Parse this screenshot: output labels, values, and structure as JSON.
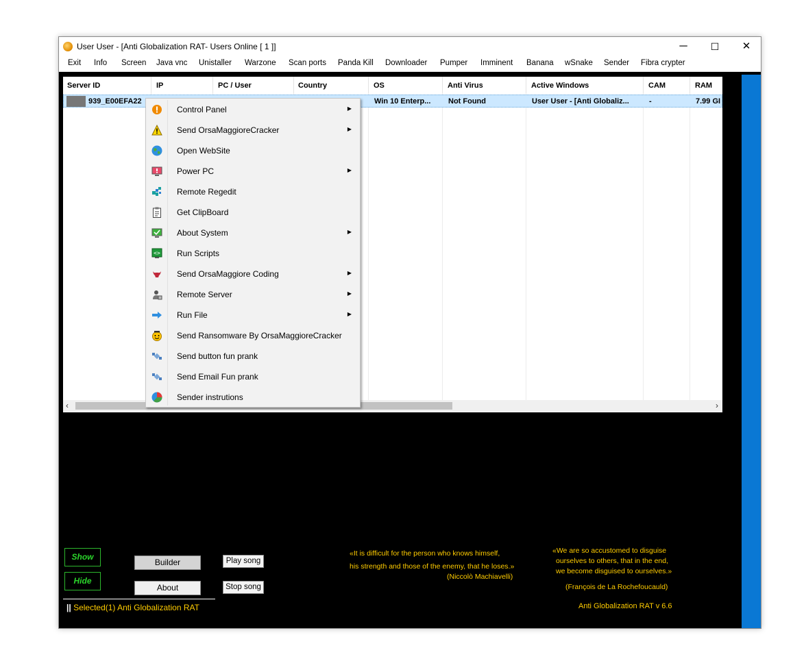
{
  "window": {
    "title": "User User - [Anti Globalization RAT- Users Online [ 1 ]]",
    "minimize_glyph": "─",
    "maximize_glyph": "☐",
    "close_glyph": "✕"
  },
  "menu": [
    "Exit",
    "Info",
    "Screen",
    "Java vnc",
    "Unistaller",
    "Warzone",
    "Scan ports",
    "Panda Kill",
    "Downloader",
    "Pumper",
    "Imminent",
    "Banana",
    "wSnake",
    "Sender",
    "Fibra crypter"
  ],
  "table": {
    "columns": [
      "Server ID",
      "IP",
      "PC / User",
      "Country",
      "OS",
      "Anti Virus",
      "Active Windows",
      "CAM",
      "RAM"
    ],
    "rows": [
      {
        "server_id": "939_E00EFA22",
        "ip": "",
        "pc_user": "",
        "country": "",
        "os": "Win 10 Enterp...",
        "antivirus": "Not Found",
        "active_windows": "User User - [Anti Globaliz...",
        "cam": "-",
        "ram": "7.99 GI"
      }
    ]
  },
  "context_menu": [
    {
      "label": "Control Panel",
      "icon": "warning-orange-icon",
      "submenu": true
    },
    {
      "label": "Send OrsaMaggioreCracker",
      "icon": "warning-triangle-icon",
      "submenu": true
    },
    {
      "label": "Open WebSite",
      "icon": "globe-icon",
      "submenu": false
    },
    {
      "label": "Power PC",
      "icon": "monitor-alert-icon",
      "submenu": true
    },
    {
      "label": "Remote Regedit",
      "icon": "registry-icon",
      "submenu": false
    },
    {
      "label": "Get ClipBoard",
      "icon": "clipboard-icon",
      "submenu": false
    },
    {
      "label": "About System",
      "icon": "monitor-check-icon",
      "submenu": true
    },
    {
      "label": "Run Scripts",
      "icon": "script-icon",
      "submenu": false
    },
    {
      "label": "Send OrsaMaggiore Coding",
      "icon": "bull-icon",
      "submenu": true
    },
    {
      "label": "Remote Server",
      "icon": "user-server-icon",
      "submenu": true
    },
    {
      "label": "Run File",
      "icon": "arrow-right-icon",
      "submenu": true
    },
    {
      "label": "Send Ransomware By OrsaMaggioreCracker",
      "icon": "smiley-icon",
      "submenu": false
    },
    {
      "label": "Send button fun prank",
      "icon": "satellite-icon",
      "submenu": false
    },
    {
      "label": "Send Email Fun prank",
      "icon": "satellite-icon",
      "submenu": false
    },
    {
      "label": "Sender instrutions",
      "icon": "pie-icon",
      "submenu": false
    }
  ],
  "buttons": {
    "show": "Show",
    "hide": "Hide",
    "builder": "Builder",
    "about": "About",
    "play_song": "Play song",
    "stop_song": "Stop song"
  },
  "quote1": {
    "line1": "«It is difficult for the person who knows himself,",
    "line2": "his strength and those of the enemy, that he loses.»",
    "author": "(Niccolò Machiavelli)"
  },
  "quote2": {
    "line1": "«We are so accustomed to disguise",
    "line2": "ourselves to others, that in the end,",
    "line3": "we become disguised to ourselves.»",
    "author": "(François de La Rochefoucauld)"
  },
  "status": "Selected(1)  Anti Globalization RAT",
  "version": "Anti Globalization RAT v 6.6",
  "colors": {
    "accent_blue": "#0a78d4",
    "quote_yellow": "#ffcc00",
    "green": "#2bd42b",
    "selection": "#cce8ff"
  }
}
